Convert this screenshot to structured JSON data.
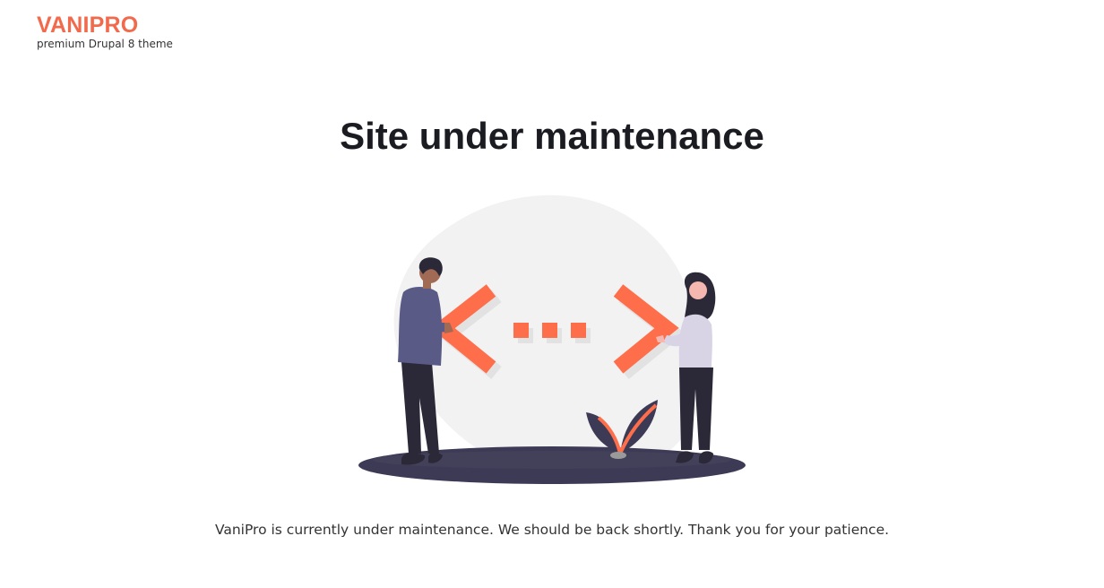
{
  "site": {
    "name": "VANIPRO",
    "tagline": "premium Drupal 8 theme"
  },
  "main": {
    "title": "Site under maintenance",
    "message": "VaniPro is currently under maintenance. We should be back shortly. Thank you for your patience."
  },
  "illustration": {
    "icon": "maintenance-illustration",
    "colors": {
      "accent": "#ff6e4a",
      "blob": "#f2f2f2",
      "ground": "#3d3a55",
      "shadow": "#e2e2e2"
    }
  },
  "colors": {
    "brand": "#f26a4b",
    "title": "#1b1b22",
    "text": "#333333",
    "background": "#ffffff"
  }
}
